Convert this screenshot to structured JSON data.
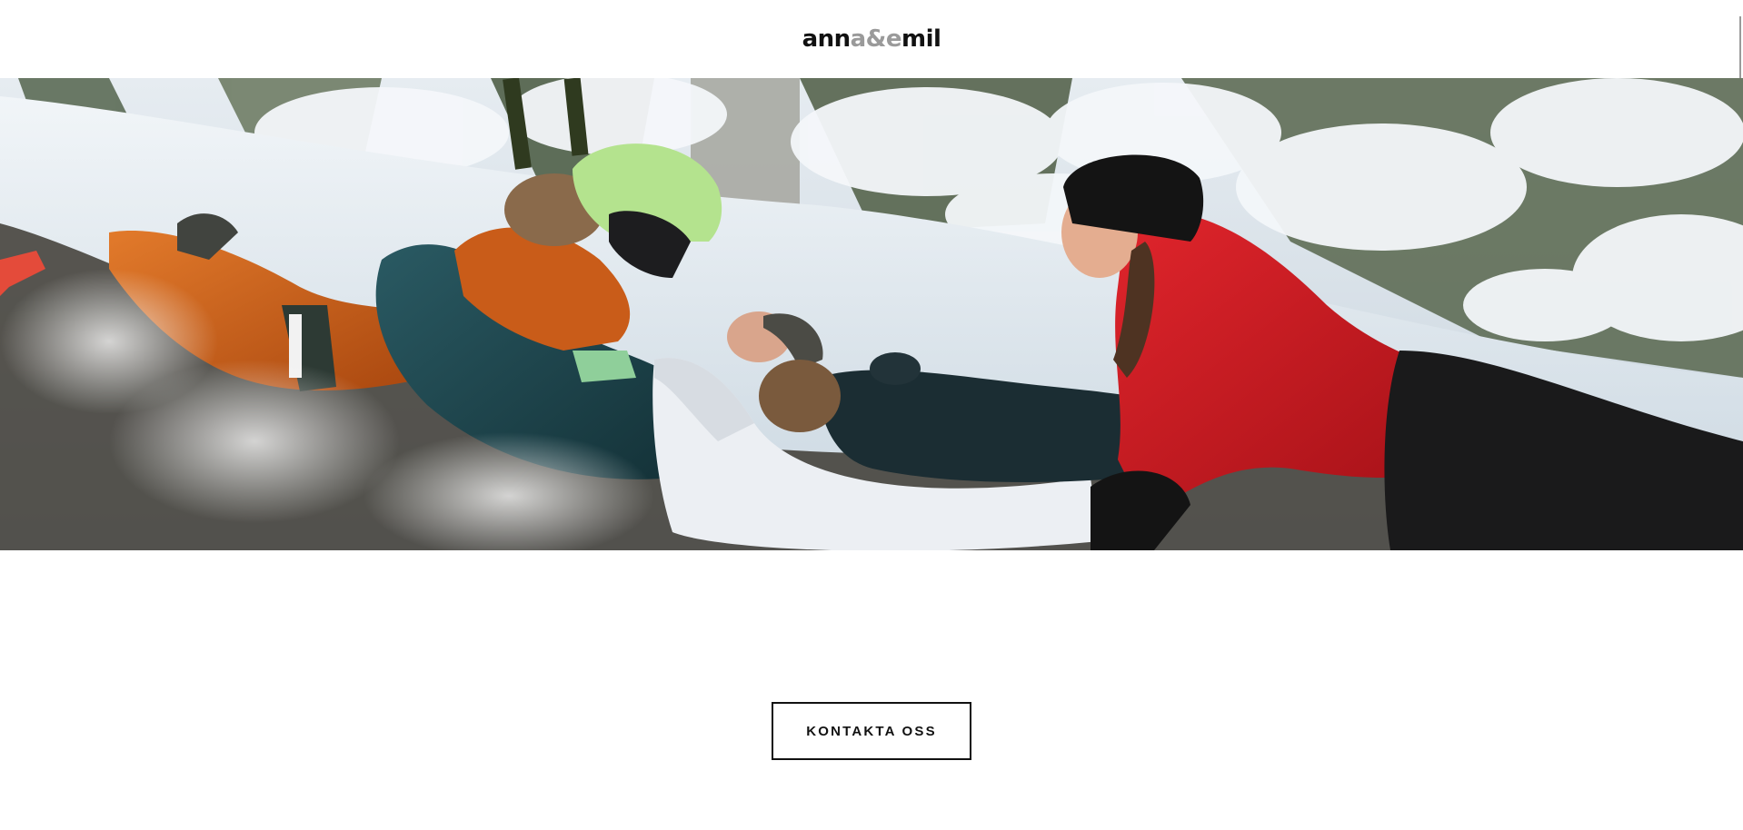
{
  "header": {
    "logo": {
      "part1": "ann",
      "part2": "a&e",
      "part3": "mil"
    }
  },
  "hero": {
    "image_icon": "hero-photo-family-sledding-snow"
  },
  "cta": {
    "label": "KONTAKTA OSS"
  },
  "colors": {
    "background": "#ffffff",
    "text": "#111111",
    "logo_accent": "#9a9a9a",
    "red_jacket": "#c8141c",
    "orange_suit": "#c65a18",
    "teal_jacket": "#1f4a52",
    "helmet": "#a8e08a"
  }
}
